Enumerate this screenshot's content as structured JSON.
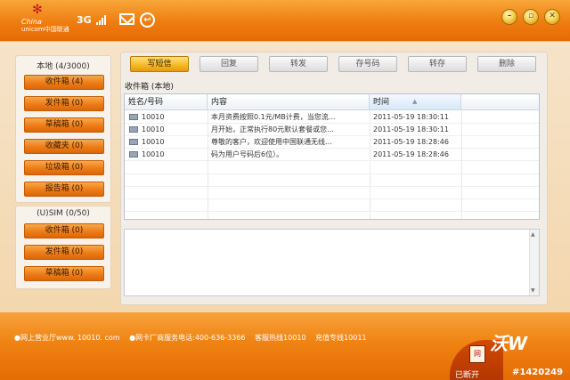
{
  "header": {
    "brand_line1": "China",
    "brand_line2": "unicom中国联通",
    "network_type": "3G"
  },
  "sidebar": {
    "local_title": "本地 (4/3000)",
    "local_items": [
      {
        "label": "收件箱 (4)"
      },
      {
        "label": "发件箱 (0)"
      },
      {
        "label": "草稿箱 (0)"
      },
      {
        "label": "收藏夹 (0)"
      },
      {
        "label": "垃圾箱 (0)"
      },
      {
        "label": "报告箱 (0)"
      }
    ],
    "sim_title": "(U)SIM (0/50)",
    "sim_items": [
      {
        "label": "收件箱 (0)"
      },
      {
        "label": "发件箱 (0)"
      },
      {
        "label": "草稿箱 (0)"
      }
    ]
  },
  "toolbar": {
    "compose": "写短信",
    "reply": "回复",
    "forward": "转发",
    "save_number": "存号码",
    "move": "转存",
    "delete": "删除"
  },
  "list": {
    "caption": "收件箱 (本地)",
    "columns": [
      "姓名/号码",
      "内容",
      "时间"
    ],
    "rows": [
      {
        "sender": "10010",
        "content": "本月资费按照0.1元/MB计费，当您流...",
        "time": "2011-05-19 18:30:11"
      },
      {
        "sender": "10010",
        "content": "月开始，正常执行80元默认套餐或您...",
        "time": "2011-05-19 18:30:11"
      },
      {
        "sender": "10010",
        "content": "尊敬的客户，欢迎使用中国联通无线...",
        "time": "2011-05-19 18:28:46"
      },
      {
        "sender": "10010",
        "content": "码为用户号码后6位）。",
        "time": "2011-05-19 18:28:46"
      }
    ]
  },
  "footer": {
    "link1": "网上营业厅www. 10010. com",
    "link2": "网卡厂商服务电话:400-636-3366",
    "link3": "客服热线10010",
    "link4": "充值专线10011",
    "status": "已断开",
    "badge": "#1420249",
    "net_badge": "网"
  }
}
